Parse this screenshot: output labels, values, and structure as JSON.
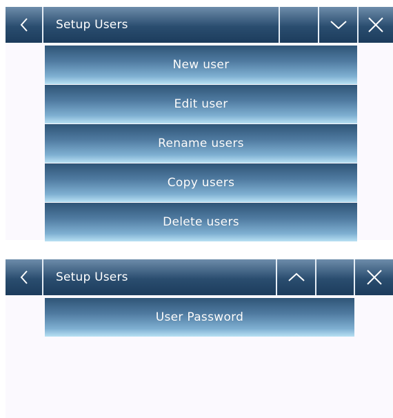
{
  "screen1": {
    "title": "Setup Users",
    "menu": [
      {
        "label": "New user"
      },
      {
        "label": "Edit user"
      },
      {
        "label": "Rename users"
      },
      {
        "label": "Copy users"
      },
      {
        "label": "Delete users"
      }
    ]
  },
  "screen2": {
    "title": "Setup Users",
    "menu": [
      {
        "label": "User Password"
      }
    ]
  },
  "icons": {
    "back": "chevron-left-icon",
    "scroll_down": "chevron-down-icon",
    "scroll_up": "chevron-up-icon",
    "close": "close-icon"
  },
  "colors": {
    "header_dark": "#1c3c5c",
    "button_light": "#b7e0f3",
    "background": "#fbf9fe"
  }
}
